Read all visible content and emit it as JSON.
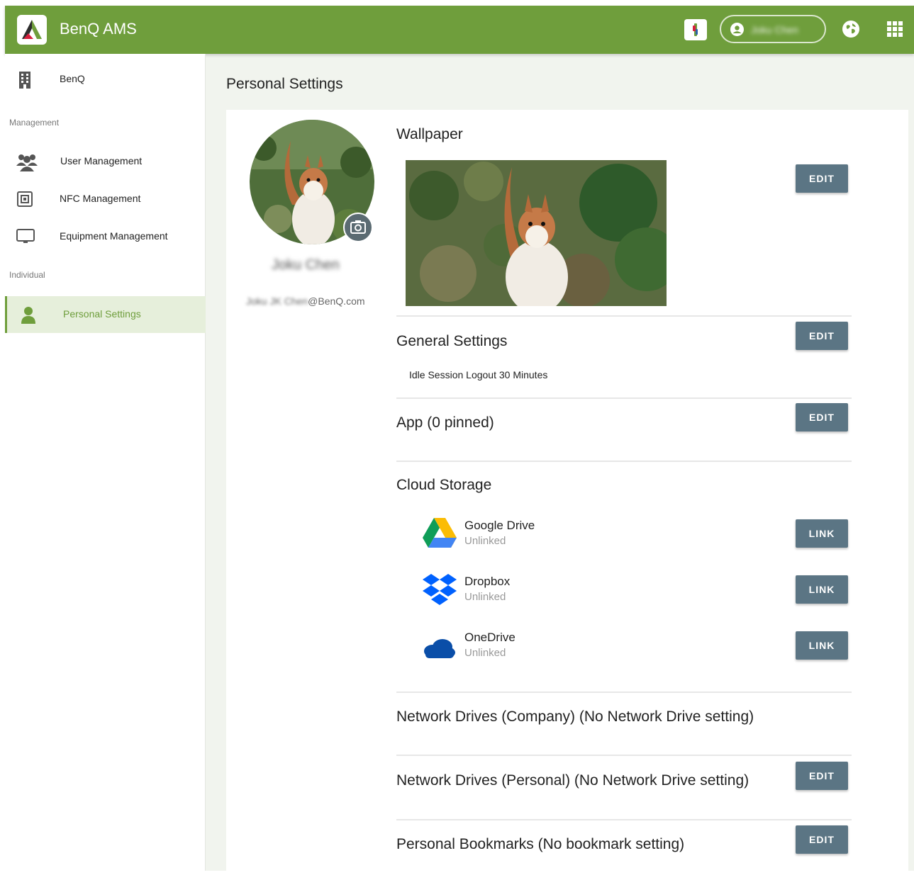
{
  "header": {
    "app_title": "BenQ AMS",
    "user_name": "Joku Chen",
    "brand_color": "#6f9e3c",
    "icons": [
      "benq-ams-logo-icon",
      "notification-badge-icon",
      "account-icon",
      "globe-icon",
      "apps-grid-icon"
    ]
  },
  "sidebar": {
    "org": {
      "label": "BenQ",
      "icon": "building-icon"
    },
    "sections": {
      "management": "Management",
      "individual": "Individual"
    },
    "items": [
      {
        "label": "User Management",
        "icon": "users-icon"
      },
      {
        "label": "NFC Management",
        "icon": "nfc-icon"
      },
      {
        "label": "Equipment Management",
        "icon": "monitor-icon"
      },
      {
        "label": "Personal Settings",
        "icon": "person-icon",
        "active": true
      }
    ]
  },
  "main": {
    "page_title": "Personal Settings",
    "profile": {
      "name": "Joku Chen",
      "email_user": "Joku JK Chen",
      "email_domain": "@BenQ.com"
    },
    "wallpaper": {
      "title": "Wallpaper",
      "edit_label": "EDIT"
    },
    "general": {
      "title": "General Settings",
      "edit_label": "EDIT",
      "setting": "Idle Session Logout 30 Minutes"
    },
    "app": {
      "title": "App (0 pinned)",
      "edit_label": "EDIT"
    },
    "cloud": {
      "title": "Cloud Storage",
      "providers": [
        {
          "name": "Google Drive",
          "status": "Unlinked",
          "action": "LINK",
          "icon": "google-drive-icon"
        },
        {
          "name": "Dropbox",
          "status": "Unlinked",
          "action": "LINK",
          "icon": "dropbox-icon"
        },
        {
          "name": "OneDrive",
          "status": "Unlinked",
          "action": "LINK",
          "icon": "onedrive-icon"
        }
      ]
    },
    "network_company": {
      "title": "Network Drives (Company) (No Network Drive setting)"
    },
    "network_personal": {
      "title": "Network Drives (Personal) (No Network Drive setting)",
      "edit_label": "EDIT"
    },
    "bookmarks": {
      "title": "Personal Bookmarks (No bookmark setting)",
      "edit_label": "EDIT"
    },
    "button_color": "#5b7584"
  }
}
